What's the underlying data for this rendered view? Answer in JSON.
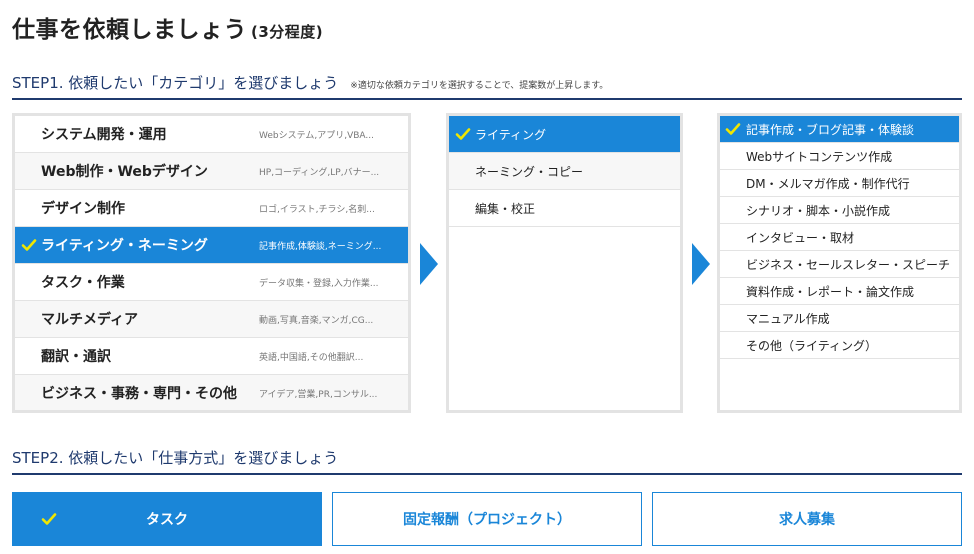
{
  "header": {
    "title": "仕事を依頼しましょう",
    "subtitle": "(3分程度)"
  },
  "step1": {
    "heading": "STEP1. 依頼したい「カテゴリ」を選びましょう",
    "note": "※適切な依頼カテゴリを選択することで、提案数が上昇します。"
  },
  "categories": [
    {
      "name": "システム開発・運用",
      "desc": "Webシステム,アプリ,VBA..."
    },
    {
      "name": "Web制作・Webデザイン",
      "desc": "HP,コーディング,LP,バナー..."
    },
    {
      "name": "デザイン制作",
      "desc": "ロゴ,イラスト,チラシ,名刺..."
    },
    {
      "name": "ライティング・ネーミング",
      "desc": "記事作成,体験談,ネーミング..."
    },
    {
      "name": "タスク・作業",
      "desc": "データ収集・登録,入力作業..."
    },
    {
      "name": "マルチメディア",
      "desc": "動画,写真,音楽,マンガ,CG..."
    },
    {
      "name": "翻訳・通訳",
      "desc": "英語,中国語,その他翻訳..."
    },
    {
      "name": "ビジネス・事務・専門・その他",
      "desc": "アイデア,営業,PR,コンサル..."
    }
  ],
  "selected_category_index": 3,
  "subcategories": [
    {
      "name": "ライティング"
    },
    {
      "name": "ネーミング・コピー"
    },
    {
      "name": "編集・校正"
    }
  ],
  "selected_subcategory_index": 0,
  "subsubcategories": [
    {
      "name": "記事作成・ブログ記事・体験談"
    },
    {
      "name": "Webサイトコンテンツ作成"
    },
    {
      "name": "DM・メルマガ作成・制作代行"
    },
    {
      "name": "シナリオ・脚本・小説作成"
    },
    {
      "name": "インタビュー・取材"
    },
    {
      "name": "ビジネス・セールスレター・スピーチ"
    },
    {
      "name": "資料作成・レポート・論文作成"
    },
    {
      "name": "マニュアル作成"
    },
    {
      "name": "その他（ライティング）"
    }
  ],
  "selected_subsubcategory_index": 0,
  "step2": {
    "heading": "STEP2. 依頼したい「仕事方式」を選びましょう",
    "methods": [
      {
        "label": "タスク"
      },
      {
        "label": "固定報酬（プロジェクト）"
      },
      {
        "label": "求人募集"
      }
    ],
    "selected_method_index": 0
  },
  "colors": {
    "accent": "#1a86d8",
    "heading": "#1f3a6e",
    "check": "#f0e600"
  },
  "icons": {
    "check": "check-icon",
    "arrow": "arrow-right-icon"
  }
}
